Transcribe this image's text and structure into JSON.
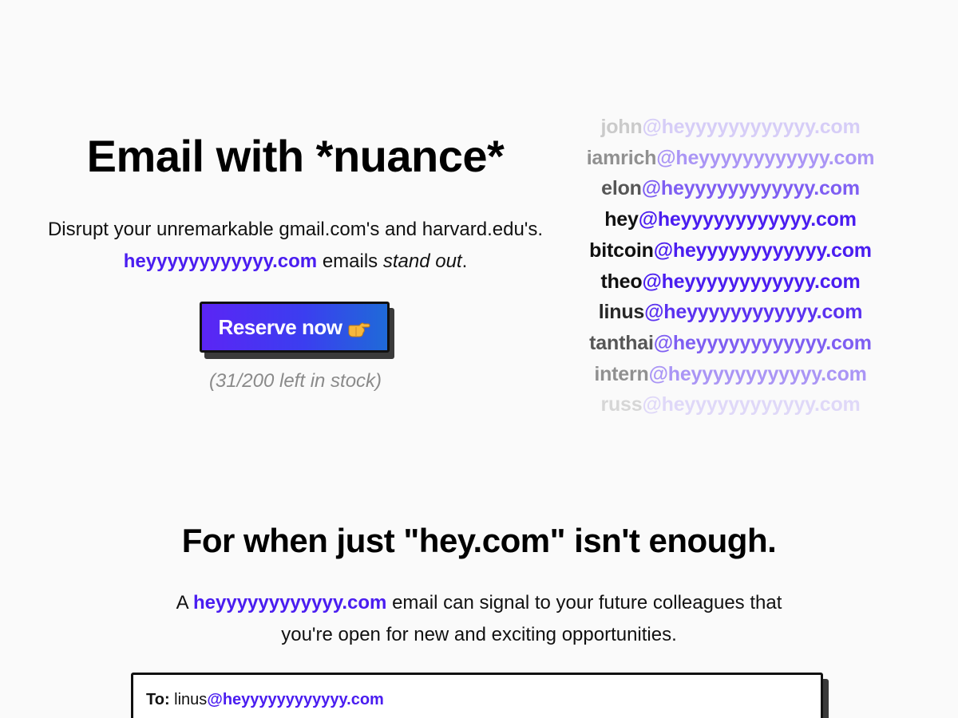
{
  "hero": {
    "title": "Email with *nuance*",
    "desc_part1": "Disrupt your unremarkable gmail.com's and harvard.edu's. ",
    "desc_brand": "heyyyyyyyyyyyy.com",
    "desc_part2": " emails ",
    "desc_emph": "stand out",
    "desc_end": ".",
    "cta_label": "Reserve now",
    "stock_text": "(31/200 left in stock)"
  },
  "email_list": {
    "domain": "@heyyyyyyyyyyyy.com",
    "rows": [
      {
        "user": "john",
        "opacity": 0.2
      },
      {
        "user": "iamrich",
        "opacity": 0.45
      },
      {
        "user": "elon",
        "opacity": 0.7
      },
      {
        "user": "hey",
        "opacity": 1.0
      },
      {
        "user": "bitcoin",
        "opacity": 1.0
      },
      {
        "user": "theo",
        "opacity": 1.0
      },
      {
        "user": "linus",
        "opacity": 0.9
      },
      {
        "user": "tanthai",
        "opacity": 0.7
      },
      {
        "user": "intern",
        "opacity": 0.45
      },
      {
        "user": "russ",
        "opacity": 0.15
      }
    ]
  },
  "section2": {
    "title": "For when just \"hey.com\" isn't enough.",
    "desc_part1": "A ",
    "desc_brand": "heyyyyyyyyyyyy.com",
    "desc_part2": " email can signal to your future colleagues that",
    "desc_line2": "you're open for new and exciting opportunities."
  },
  "email_card": {
    "to_label": "To:",
    "to_user": "linus",
    "to_domain": "@heyyyyyyyyyyyy.com"
  },
  "colors": {
    "brand": "#4a1df0",
    "background": "#fafafa",
    "muted": "#8a8a8a"
  },
  "icons": {
    "cta_icon": "pointing-hand-icon"
  }
}
